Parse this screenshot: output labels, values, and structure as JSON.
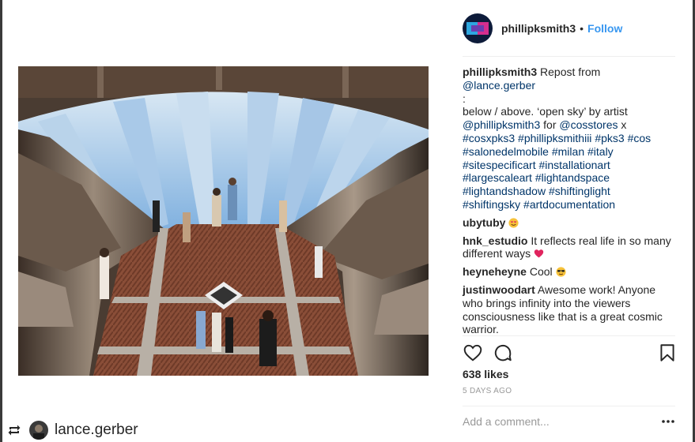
{
  "post": {
    "author": "phillipksmith3",
    "dot": "•",
    "follow_label": "Follow",
    "likes": "638 likes",
    "date": "5 DAYS AGO",
    "add_comment_placeholder": "Add a comment..."
  },
  "caption": {
    "user": "phillipksmith3",
    "repost_text": "Repost from",
    "repost_handle": "@lance.gerber",
    "colon": ":",
    "body": "below / above. ‘open sky’ by artist",
    "artist_handle": "@phillipksmith3",
    "for_text": "for",
    "brand_handle": "@cosstores",
    "x_text": "x",
    "hashtags": [
      "#cosxpks3",
      "#phillipksmithiii",
      "#pks3",
      "#cos",
      "#salonedelmobile",
      "#milan",
      "#italy",
      "#sitespecificart",
      "#installationart",
      "#largescaleart",
      "#lightandspace",
      "#lightandshadow",
      "#shiftinglight",
      "#shiftingsky",
      "#artdocumentation"
    ]
  },
  "comments": [
    {
      "user": "ubytuby",
      "text": "",
      "emoji": "heart-eyes"
    },
    {
      "user": "hnk_estudio",
      "text": "It reflects real life in so many different ways",
      "emoji": "red-heart"
    },
    {
      "user": "heyneheyne",
      "text": "Cool",
      "emoji": "sunglasses"
    },
    {
      "user": "justinwoodart",
      "text": "Awesome work! Anyone who brings infinity into the viewers consciousness like that is a great cosmic warrior.",
      "emoji": ""
    }
  ],
  "footer": {
    "repost_user": "lance.gerber"
  },
  "colors": {
    "link": "#3897f0",
    "hashtag": "#003569",
    "text": "#262626",
    "muted": "#999999"
  },
  "icons": [
    "heart-icon",
    "comment-icon",
    "bookmark-icon",
    "more-icon",
    "repost-icon"
  ]
}
